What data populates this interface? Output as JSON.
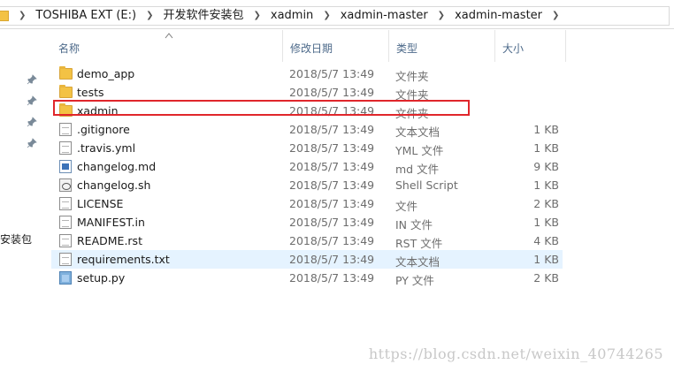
{
  "address": {
    "crumbs": [
      "TOSHIBA EXT (E:)",
      "开发软件安装包",
      "xadmin",
      "xadmin-master",
      "xadmin-master"
    ],
    "separator": "❯"
  },
  "navpane": {
    "cut_label": "安装包"
  },
  "columns": {
    "name": "名称",
    "date": "修改日期",
    "type": "类型",
    "size": "大小"
  },
  "files": [
    {
      "name": "demo_app",
      "date": "2018/5/7 13:49",
      "type": "文件夹",
      "size": "",
      "icon": "folder-icon"
    },
    {
      "name": "tests",
      "date": "2018/5/7 13:49",
      "type": "文件夹",
      "size": "",
      "icon": "folder-icon"
    },
    {
      "name": "xadmin",
      "date": "2018/5/7 13:49",
      "type": "文件夹",
      "size": "",
      "icon": "folder-icon"
    },
    {
      "name": ".gitignore",
      "date": "2018/5/7 13:49",
      "type": "文本文档",
      "size": "1 KB",
      "icon": "text-file-icon"
    },
    {
      "name": ".travis.yml",
      "date": "2018/5/7 13:49",
      "type": "YML 文件",
      "size": "1 KB",
      "icon": "text-file-icon"
    },
    {
      "name": "changelog.md",
      "date": "2018/5/7 13:49",
      "type": "md 文件",
      "size": "9 KB",
      "icon": "markdown-file-icon"
    },
    {
      "name": "changelog.sh",
      "date": "2018/5/7 13:49",
      "type": "Shell Script",
      "size": "1 KB",
      "icon": "shell-script-icon"
    },
    {
      "name": "LICENSE",
      "date": "2018/5/7 13:49",
      "type": "文件",
      "size": "2 KB",
      "icon": "text-file-icon"
    },
    {
      "name": "MANIFEST.in",
      "date": "2018/5/7 13:49",
      "type": "IN 文件",
      "size": "1 KB",
      "icon": "text-file-icon"
    },
    {
      "name": "README.rst",
      "date": "2018/5/7 13:49",
      "type": "RST 文件",
      "size": "4 KB",
      "icon": "text-file-icon"
    },
    {
      "name": "requirements.txt",
      "date": "2018/5/7 13:49",
      "type": "文本文档",
      "size": "1 KB",
      "icon": "text-file-icon"
    },
    {
      "name": "setup.py",
      "date": "2018/5/7 13:49",
      "type": "PY 文件",
      "size": "2 KB",
      "icon": "python-file-icon"
    }
  ],
  "hover_row": "requirements.txt",
  "highlighted_row": "xadmin",
  "colors": {
    "highlight_box": "#e0262b",
    "hover_row_bg": "#e5f3ff",
    "header_text": "#4d6a8a"
  },
  "watermark": "https://blog.csdn.net/weixin_40744265"
}
